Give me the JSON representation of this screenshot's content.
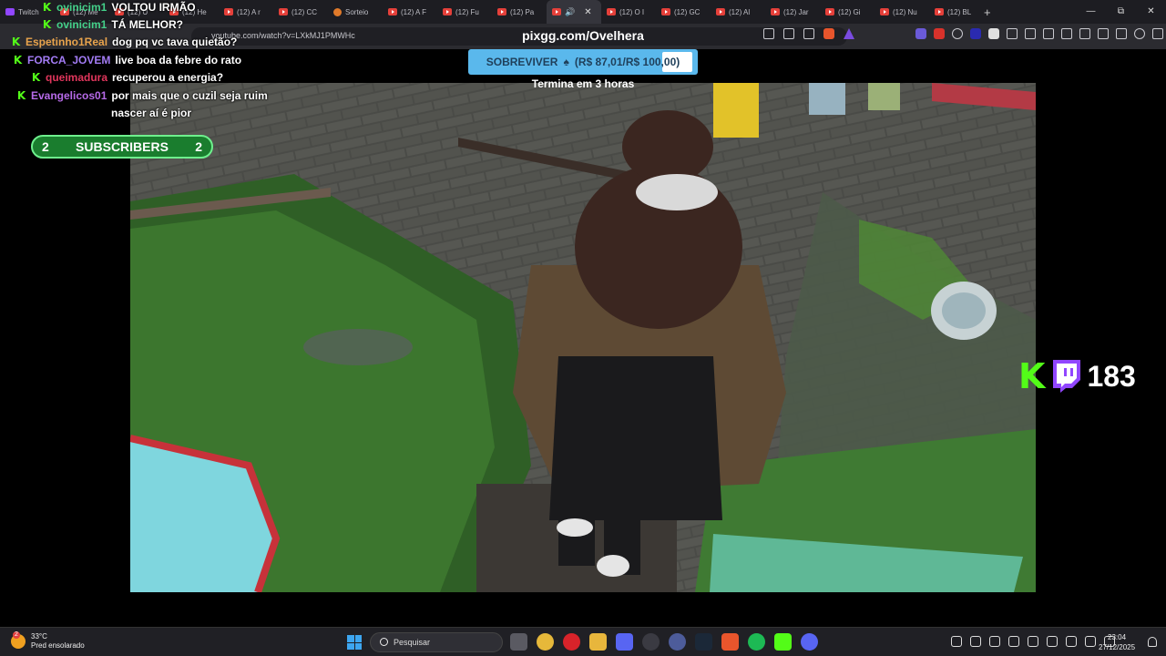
{
  "browser": {
    "tabs": [
      {
        "label": "Twitch",
        "icon": "twitch-icon"
      },
      {
        "label": "(12) Me",
        "icon": "youtube-icon"
      },
      {
        "label": "(12) U",
        "icon": "youtube-icon"
      },
      {
        "label": "(12) He",
        "icon": "youtube-icon"
      },
      {
        "label": "(12) A r",
        "icon": "youtube-icon"
      },
      {
        "label": "(12) CC",
        "icon": "youtube-icon"
      },
      {
        "label": "Sorteio",
        "icon": "coin-icon"
      },
      {
        "label": "(12) A F",
        "icon": "youtube-icon"
      },
      {
        "label": "(12) Fu",
        "icon": "youtube-icon"
      },
      {
        "label": "(12) Pa",
        "icon": "youtube-icon"
      },
      {
        "label": "(12) O I",
        "icon": "youtube-icon"
      },
      {
        "label": "(12) GC",
        "icon": "youtube-icon"
      },
      {
        "label": "(12) Al",
        "icon": "youtube-icon"
      },
      {
        "label": "(12) Jar",
        "icon": "youtube-icon"
      },
      {
        "label": "(12) Gi",
        "icon": "youtube-icon"
      },
      {
        "label": "(12) Nu",
        "icon": "youtube-icon"
      },
      {
        "label": "(12) BL",
        "icon": "youtube-icon"
      }
    ],
    "url": "youtube.com/watch?v=LXkMJ1PMWHc"
  },
  "overlay": {
    "pix_url": "pixgg.com/Ovelhera",
    "goal_label": "SOBREVIVER",
    "goal_amount": "(R$ 87,01/R$ 100,00)",
    "goal_progress": 0.87,
    "goal_end": "Termina em 3 horas",
    "subscribers_label": "SUBSCRIBERS",
    "subscribers_left": "2",
    "subscribers_right": "2",
    "viewer_count": "183"
  },
  "chat": [
    {
      "user": "ovinicim1",
      "text": "VOLTOU IRMÃO",
      "color": "#44d18a"
    },
    {
      "user": "ovinicim1",
      "text": "TÁ MELHOR?",
      "color": "#44d18a"
    },
    {
      "user": "Espetinho1Real",
      "text": "dog pq vc tava quietão?",
      "color": "#e8a34c"
    },
    {
      "user": "FORCA_JOVEM",
      "text": "live boa da febre do rato",
      "color": "#a37cf5"
    },
    {
      "user": "queimadura",
      "text": "recuperou a energia?",
      "color": "#e0365c"
    },
    {
      "user": "Evangelicos01",
      "text": "por mais que o cuzil seja ruim",
      "color": "#b66ae8"
    },
    {
      "user": "",
      "text": "nascer aí é pior",
      "color": "#ffffff"
    }
  ],
  "taskbar": {
    "temperature": "33°C",
    "weather": "Pred ensolarado",
    "search_placeholder": "Pesquisar",
    "time": "23:04",
    "date": "27/12/2025"
  }
}
